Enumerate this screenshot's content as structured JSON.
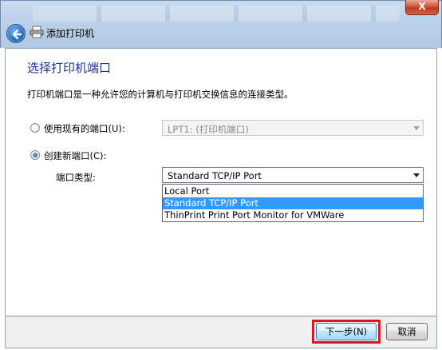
{
  "window": {
    "title": "添加打印机",
    "close_glyph": "X",
    "accent_color": "#1e3287"
  },
  "page": {
    "heading": "选择打印机端口",
    "description": "打印机端口是一种允许您的计算机与打印机交换信息的连接类型。"
  },
  "use_existing": {
    "label": "使用现有的端口(U):",
    "checked": false,
    "combo_value": "LPT1: (打印机端口)",
    "enabled": false
  },
  "create_new": {
    "label": "创建新端口(C):",
    "checked": true,
    "port_type_label": "端口类型:",
    "combo_value": "Standard TCP/IP Port",
    "options": [
      {
        "label": "Local Port",
        "selected": false
      },
      {
        "label": "Standard TCP/IP Port",
        "selected": true
      },
      {
        "label": "ThinPrint Print Port Monitor for VMWare",
        "selected": false
      }
    ]
  },
  "buttons": {
    "next_label": "下一步(N)",
    "cancel_label": "取消"
  },
  "icons": {
    "back": "back-arrow-icon",
    "printer": "printer-icon",
    "dropdown": "chevron-down-icon"
  }
}
